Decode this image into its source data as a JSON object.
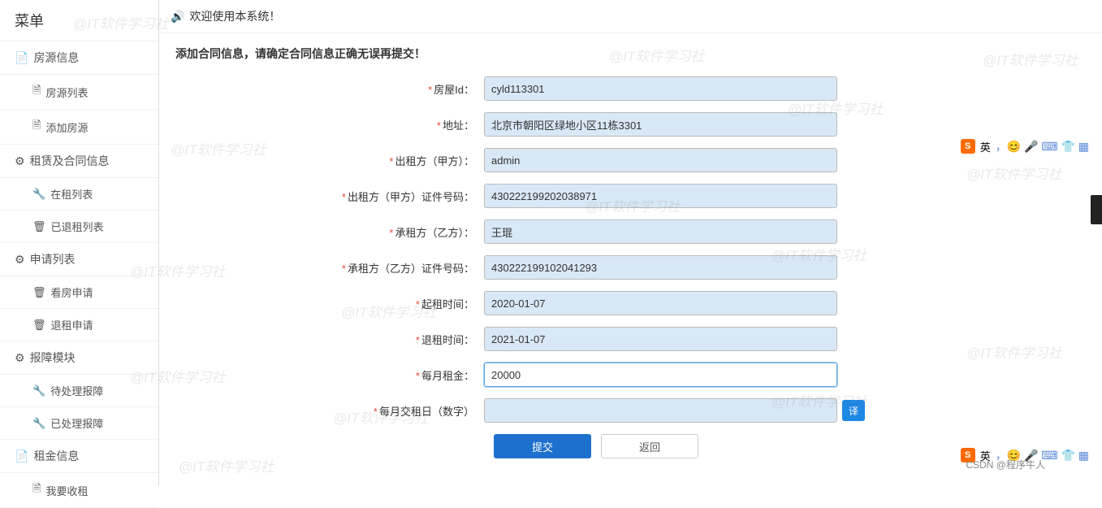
{
  "sidebar": {
    "title": "菜单",
    "groups": [
      {
        "label": "房源信息",
        "icon": "📄",
        "items": [
          {
            "label": "房源列表",
            "icon": "🗎"
          },
          {
            "label": "添加房源",
            "icon": "🗎"
          }
        ]
      },
      {
        "label": "租赁及合同信息",
        "icon": "⚙",
        "items": [
          {
            "label": "在租列表",
            "icon": "🔧"
          },
          {
            "label": "已退租列表",
            "icon": "🗑"
          }
        ]
      },
      {
        "label": "申请列表",
        "icon": "⚙",
        "items": [
          {
            "label": "看房申请",
            "icon": "🗑"
          },
          {
            "label": "退租申请",
            "icon": "🗑"
          }
        ]
      },
      {
        "label": "报障模块",
        "icon": "⚙",
        "items": [
          {
            "label": "待处理报障",
            "icon": "🔧"
          },
          {
            "label": "已处理报障",
            "icon": "🔧"
          }
        ]
      },
      {
        "label": "租金信息",
        "icon": "📄",
        "items": [
          {
            "label": "我要收租",
            "icon": "🗎"
          }
        ]
      }
    ]
  },
  "topbar": {
    "welcome": "欢迎使用本系统！",
    "icon": "🔊"
  },
  "form": {
    "heading": "添加合同信息，请确定合同信息正确无误再提交！",
    "fields": {
      "room_id": {
        "label": "房屋Id：",
        "value": "cyld113301",
        "required": true
      },
      "address": {
        "label": "地址：",
        "value": "北京市朝阳区绿地小区11栋3301",
        "required": true
      },
      "landlord": {
        "label": "出租方（甲方）：",
        "value": "admin",
        "required": true
      },
      "landlord_id": {
        "label": "出租方（甲方）证件号码：",
        "value": "430222199202038971",
        "required": true
      },
      "tenant": {
        "label": "承租方（乙方）：",
        "value": "王琨",
        "required": true
      },
      "tenant_id": {
        "label": "承租方（乙方）证件号码：",
        "value": "430222199102041293",
        "required": true
      },
      "start": {
        "label": "起租时间：",
        "value": "2020-01-07",
        "required": true
      },
      "end": {
        "label": "退租时间：",
        "value": "2021-01-07",
        "required": true
      },
      "rent": {
        "label": "每月租金：",
        "value": "20000",
        "required": true,
        "focused": true
      },
      "pay_day": {
        "label": "每月交租日（数字）",
        "value": "",
        "required": true,
        "translate": "译"
      }
    },
    "buttons": {
      "submit": "提交",
      "back": "返回"
    }
  },
  "watermark_text": "@IT软件学习社",
  "ime": {
    "lang": "英",
    "icons": "，😊 🎤 ⌨ 👕 ▦"
  },
  "credit": "CSDN @程序牛人"
}
